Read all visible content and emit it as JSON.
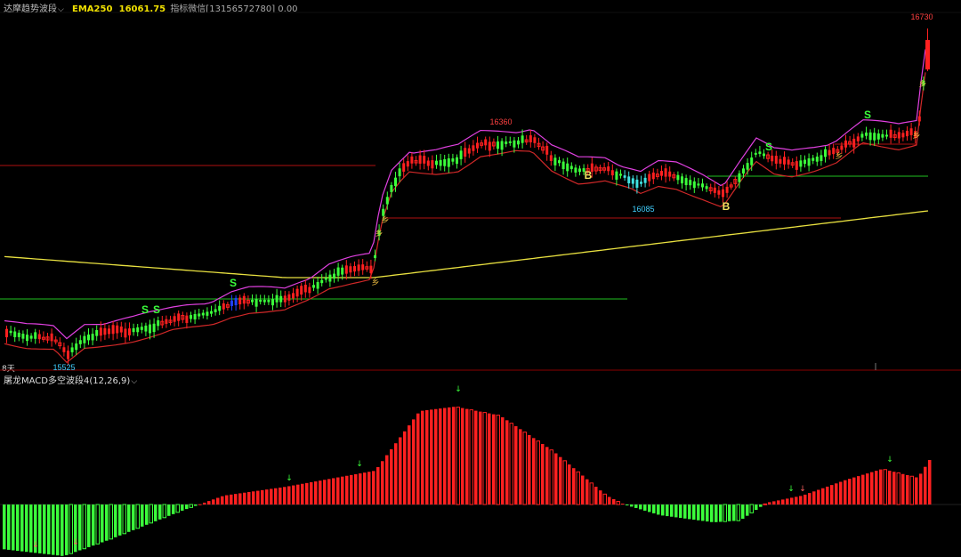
{
  "header": {
    "indicator_name": "达摩趋势波段",
    "ema_label": "EMA250",
    "ema_value": "16061.75",
    "note": "指标微信[13156572780] 0.00"
  },
  "days_label": "8天",
  "macd_header": "屠龙MACD多空波段4(12,26,9)",
  "colors": {
    "up": "#ff2020",
    "down": "#3bff3b",
    "ema250": "#e8e040",
    "band_upper": "#e040e0",
    "band_lower_down": "#40e0e0",
    "band_lower_up": "#ff3030",
    "signal_S": "#3bff3b",
    "signal_B": "#f0e060",
    "label_high": "#ff4040",
    "label_low": "#40d0ff"
  },
  "chart_data": [
    {
      "type": "candlestick",
      "title": "达摩趋势波段",
      "price_labels": {
        "high_1": "16360",
        "high_2": "16730",
        "low_1": "15525",
        "low_2": "16085"
      },
      "ema250_value": 16061.75,
      "signals": [
        {
          "text": "S",
          "at": "bar-28"
        },
        {
          "text": "S",
          "at": "bar-32"
        },
        {
          "text": "S",
          "at": "bar-58"
        },
        {
          "text": "B",
          "at": "bar-148"
        },
        {
          "text": "B",
          "at": "bar-181"
        },
        {
          "text": "S",
          "at": "bar-193"
        },
        {
          "text": "S",
          "at": "bar-219"
        }
      ],
      "marker_glyph": "乡"
    },
    {
      "type": "bar",
      "title": "屠龙MACD多空波段4(12,26,9)",
      "parameters": [
        12,
        26,
        9
      ]
    }
  ]
}
